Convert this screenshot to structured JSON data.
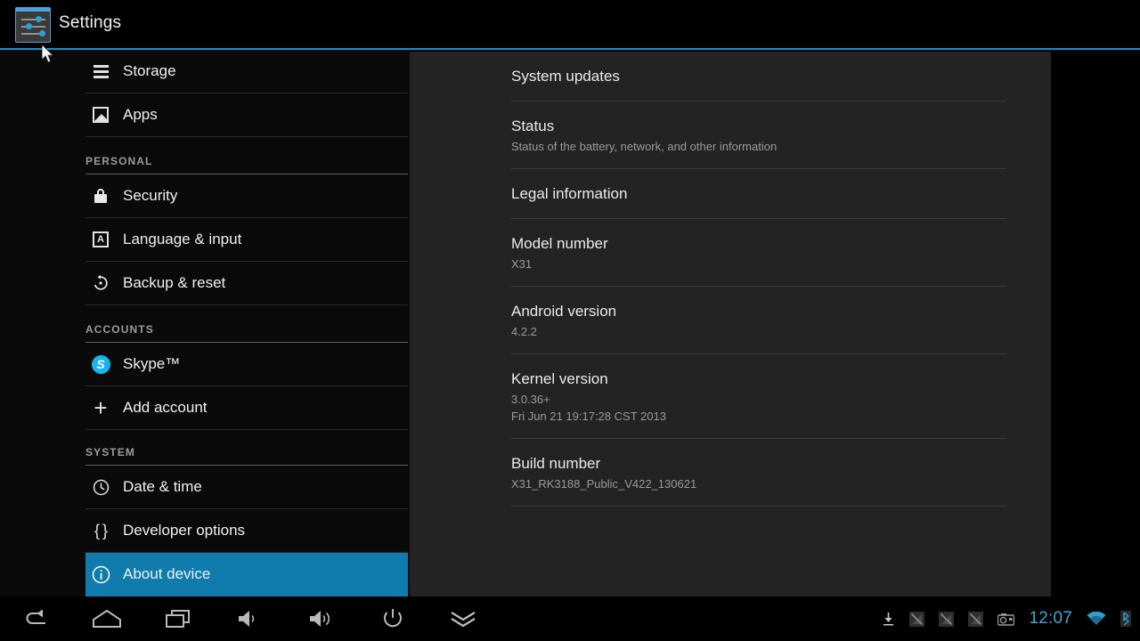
{
  "window": {
    "app_title": "Settings",
    "app_icon": "settings-sliders-icon",
    "accent_color": "#1b8fc4",
    "highlight_color": "#0f7cad"
  },
  "sidebar": {
    "items": [
      {
        "type": "item",
        "label": "Storage",
        "icon": "storage-icon",
        "selected": false
      },
      {
        "type": "item",
        "label": "Apps",
        "icon": "apps-icon",
        "selected": false
      },
      {
        "type": "header",
        "label": "PERSONAL"
      },
      {
        "type": "item",
        "label": "Security",
        "icon": "lock-icon",
        "selected": false
      },
      {
        "type": "item",
        "label": "Language & input",
        "icon": "language-icon",
        "selected": false
      },
      {
        "type": "item",
        "label": "Backup & reset",
        "icon": "backup-reset-icon",
        "selected": false
      },
      {
        "type": "header",
        "label": "ACCOUNTS"
      },
      {
        "type": "item",
        "label": "Skype™",
        "icon": "skype-icon",
        "selected": false
      },
      {
        "type": "item",
        "label": "Add account",
        "icon": "plus-icon",
        "selected": false
      },
      {
        "type": "header",
        "label": "SYSTEM"
      },
      {
        "type": "item",
        "label": "Date & time",
        "icon": "clock-icon",
        "selected": false
      },
      {
        "type": "item",
        "label": "Developer options",
        "icon": "braces-icon",
        "selected": false
      },
      {
        "type": "item",
        "label": "About device",
        "icon": "info-circle-icon",
        "selected": true
      }
    ]
  },
  "content": {
    "prefs": [
      {
        "title": "System updates",
        "sub": ""
      },
      {
        "title": "Status",
        "sub": "Status of the battery, network, and other information"
      },
      {
        "title": "Legal information",
        "sub": ""
      },
      {
        "title": "Model number",
        "sub": "X31"
      },
      {
        "title": "Android version",
        "sub": "4.2.2"
      },
      {
        "title": "Kernel version",
        "sub": "3.0.36+\nFri Jun 21 19:17:28 CST 2013"
      },
      {
        "title": "Build number",
        "sub": "X31_RK3188_Public_V422_130621"
      }
    ]
  },
  "navbar": {
    "buttons": [
      {
        "name": "back-icon"
      },
      {
        "name": "home-icon"
      },
      {
        "name": "recents-icon"
      },
      {
        "name": "volume-down-icon"
      },
      {
        "name": "volume-up-icon"
      },
      {
        "name": "power-icon"
      },
      {
        "name": "hide-navbar-icon"
      }
    ]
  },
  "statusbar": {
    "icons": [
      "download-icon",
      "no-signal-icon",
      "no-signal-icon",
      "no-signal-icon",
      "screenshot-camera-icon",
      "wifi-icon",
      "bluetooth-icon"
    ],
    "clock": "12:07",
    "clock_color": "#3ca7d8"
  }
}
